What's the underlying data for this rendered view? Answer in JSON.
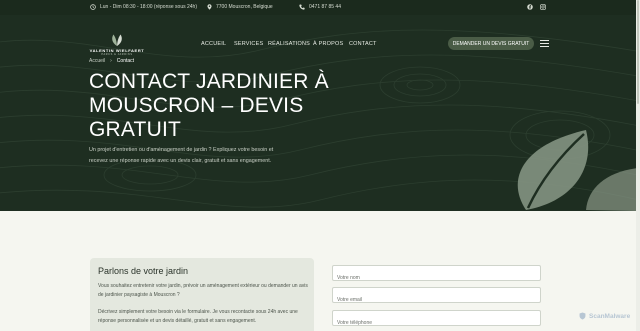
{
  "topbar": {
    "hours": "Lun - Dim 08:30 - 18:00 (réponse sous 24h)",
    "address": "7700 Mouscron, Belgique",
    "phone": "0471 87 85 44",
    "social_icons": [
      "facebook-icon",
      "instagram-icon"
    ]
  },
  "logo": {
    "name": "VALENTIN WIELFAERT",
    "tagline": "PARCS & JARDINS"
  },
  "nav": {
    "items": [
      "ACCUEIL",
      "SERVICES",
      "RÉALISATIONS",
      "À PROPOS",
      "CONTACT"
    ],
    "cta": "DEMANDER UN DEVIS GRATUIT",
    "menu_icon": "hamburger-icon"
  },
  "breadcrumb": {
    "home": "Accueil",
    "separator": "›",
    "current": "Contact"
  },
  "hero": {
    "title": "CONTACT JARDINIER À MOUSCRON – DEVIS GRATUIT",
    "intro": "Un projet d'entretien ou d'aménagement de jardin ? Expliquez votre besoin et recevez une réponse rapide avec un devis clair, gratuit et sans engagement."
  },
  "card": {
    "title": "Parlons de votre jardin",
    "p1": "Vous souhaitez entretenir votre jardin, prévoir un aménagement extérieur ou demander un avis de jardinier paysagiste à Mouscron ?",
    "p2": "Décrivez simplement votre besoin via le formulaire. Je vous recontacte sous 24h avec une réponse personnalisée et un devis détaillé, gratuit et sans engagement."
  },
  "form": {
    "name_placeholder": "Votre nom",
    "email_placeholder": "Votre email",
    "phone_placeholder": "Votre téléphone"
  },
  "watermark": {
    "text": "ScanMalware"
  },
  "colors": {
    "hero_bg": "#1e2e21",
    "topbar_bg": "#1b2a1d",
    "cta_bg": "#4a5c46",
    "card_bg": "#e4e8df",
    "page_bg": "#f5f6f0"
  }
}
